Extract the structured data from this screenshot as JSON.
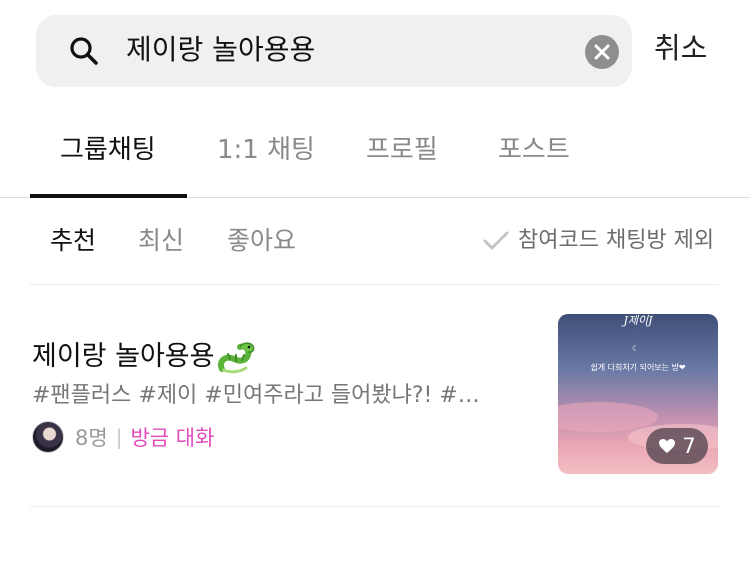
{
  "search": {
    "query": "제이랑 놀아용용",
    "cancel_label": "취소"
  },
  "tabs": [
    {
      "label": "그룹채팅",
      "active": true
    },
    {
      "label": "1:1 채팅",
      "active": false
    },
    {
      "label": "프로필",
      "active": false
    },
    {
      "label": "포스트",
      "active": false
    }
  ],
  "sort": {
    "options": [
      {
        "label": "추천",
        "active": true
      },
      {
        "label": "최신",
        "active": false
      },
      {
        "label": "좋아요",
        "active": false
      }
    ],
    "filter_label": "참여코드 채팅방 제외"
  },
  "results": [
    {
      "title": "제이랑 놀아용용",
      "title_emoji": "dragon-emoji",
      "tags": "#팬플러스 #제이 #민여주라고 들어봤냐?! #…",
      "members": "8명",
      "activity": "방금 대화",
      "thumbnail": {
        "title": "J제이J",
        "caption": "쉽게 다희처기 되어보는 방❤"
      },
      "likes": "7"
    }
  ],
  "colors": {
    "activity": "#e24dbb",
    "search_bg": "#f0f0f0",
    "active_tab": "#111111",
    "inactive": "#8a8a8a"
  }
}
